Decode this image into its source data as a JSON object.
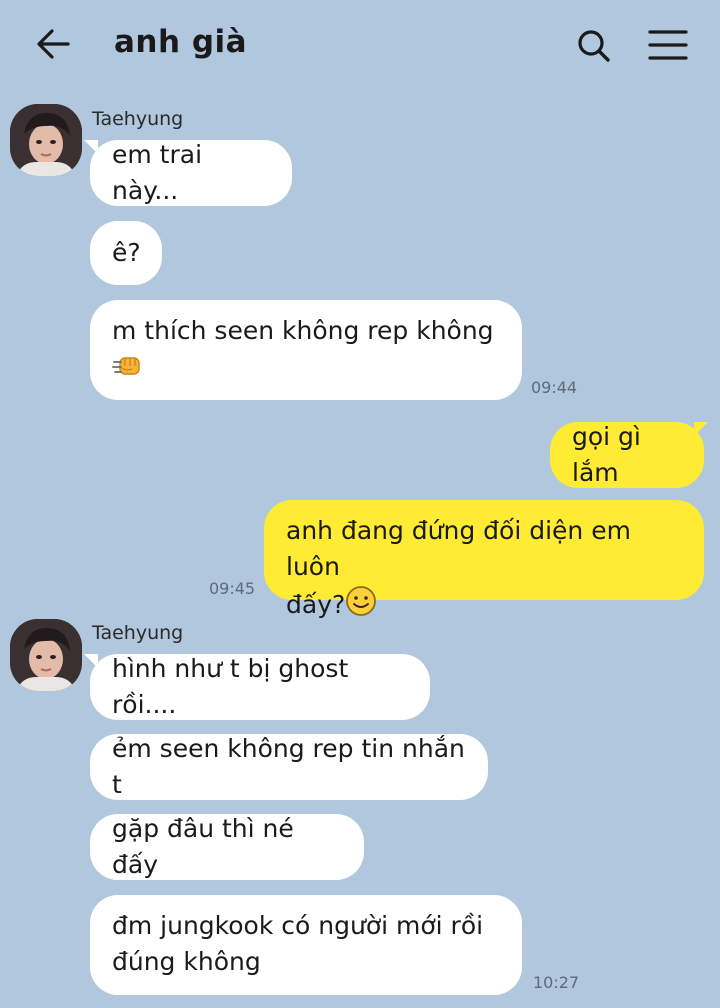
{
  "header": {
    "title": "anh già",
    "back_icon": "arrow-left-icon",
    "search_icon": "search-icon",
    "menu_icon": "hamburger-menu-icon"
  },
  "colors": {
    "background": "#b1c7dd",
    "incoming_bubble": "#ffffff",
    "outgoing_bubble": "#ffeb33"
  },
  "messages": {
    "group1": {
      "sender": "Taehyung",
      "msg1": "em trai này...",
      "msg2": "ê?",
      "msg3": "m thích seen không rep không",
      "msg3_emoji": "punch-fist-emoji",
      "time": "09:44"
    },
    "outgoing": {
      "msg1": "gọi gì lắm",
      "msg2_line1": "anh đang đứng đối diện em luôn",
      "msg2_line2": "đấy?",
      "msg2_emoji": "smiling-face-emoji",
      "time": "09:45"
    },
    "group2": {
      "sender": "Taehyung",
      "msg1": "hình như t bị ghost rồi....",
      "msg2": "ẻm seen không rep tin nhắn t",
      "msg3": "gặp đâu thì né đấy",
      "msg4_line1": "đm jungkook có người mới rồi",
      "msg4_line2": "đúng không",
      "time": "10:27"
    }
  }
}
